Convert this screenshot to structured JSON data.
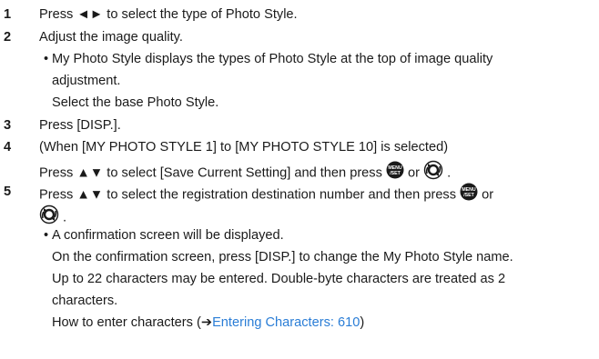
{
  "steps": {
    "s1": {
      "number": "1",
      "pre": "Press ",
      "arrows": "◄►",
      "post": " to select the type of Photo Style."
    },
    "s2": {
      "number": "2",
      "text": "Adjust the image quality.",
      "bullet": "•",
      "note_line1": "My Photo Style displays the types of Photo Style at the top of image quality",
      "note_line2": "adjustment.",
      "note_line3": "Select the base Photo Style."
    },
    "s3": {
      "number": "3",
      "text": "Press [DISP.]."
    },
    "s4": {
      "number": "4",
      "line1": "(When [MY PHOTO STYLE 1] to [MY PHOTO STYLE 10] is selected)",
      "pre": "Press ",
      "arrows": "▲▼",
      "mid": " to select [Save Current Setting] and then press ",
      "or": " or ",
      "end": " ."
    },
    "s5": {
      "number": "5",
      "pre": "Press ",
      "arrows": "▲▼",
      "mid": " to select the registration destination number and then press ",
      "or": " or",
      "end": " .",
      "bullet": "•",
      "note_line1": "A confirmation screen will be displayed.",
      "note_line2": "On the confirmation screen, press [DISP.] to change the My Photo Style name.",
      "note_line3": "Up to 22 characters may be entered. Double-byte characters are treated as 2",
      "note_line4": "characters.",
      "note_line5_pre": "How to enter characters (",
      "note_line5_arrow": "➔",
      "note_line5_link": "Entering Characters: 610",
      "note_line5_post": ")"
    }
  },
  "icons": {
    "menu_set": {
      "name": "menu-set-button-icon",
      "text_top": "MENU",
      "text_bottom": "/SET",
      "color": "#1a1a1a"
    },
    "control_dial": {
      "name": "control-dial-icon",
      "color": "#1a1a1a"
    }
  },
  "colors": {
    "text": "#1a1a1a",
    "link": "#2a7dd6"
  }
}
